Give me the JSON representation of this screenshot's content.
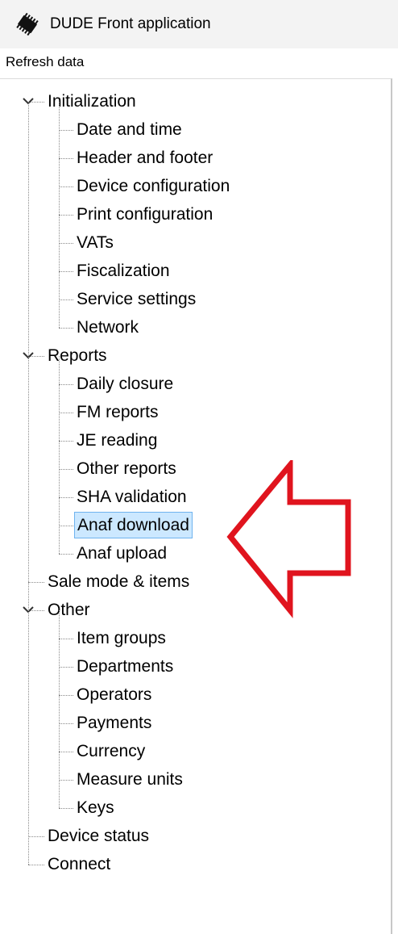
{
  "window": {
    "title": "DUDE Front application",
    "icon": "chip-icon"
  },
  "menu": {
    "refresh": "Refresh data"
  },
  "tree": {
    "initialization": {
      "label": "Initialization",
      "children": [
        "Date and time",
        "Header and footer",
        "Device configuration",
        "Print configuration",
        "VATs",
        "Fiscalization",
        "Service settings",
        "Network"
      ]
    },
    "reports": {
      "label": "Reports",
      "children": [
        "Daily closure",
        "FM reports",
        "JE reading",
        "Other reports",
        "SHA validation",
        "Anaf download",
        "Anaf upload"
      ]
    },
    "sale_mode": "Sale mode & items",
    "other": {
      "label": "Other",
      "children": [
        "Item groups",
        "Departments",
        "Operators",
        "Payments",
        "Currency",
        "Measure units",
        "Keys"
      ]
    },
    "device_status": "Device status",
    "connect": "Connect",
    "selected": "Anaf download"
  },
  "colors": {
    "selection_bg": "#cce8ff",
    "selection_border": "#6fb3ef",
    "annotation_arrow": "#e0141e"
  }
}
